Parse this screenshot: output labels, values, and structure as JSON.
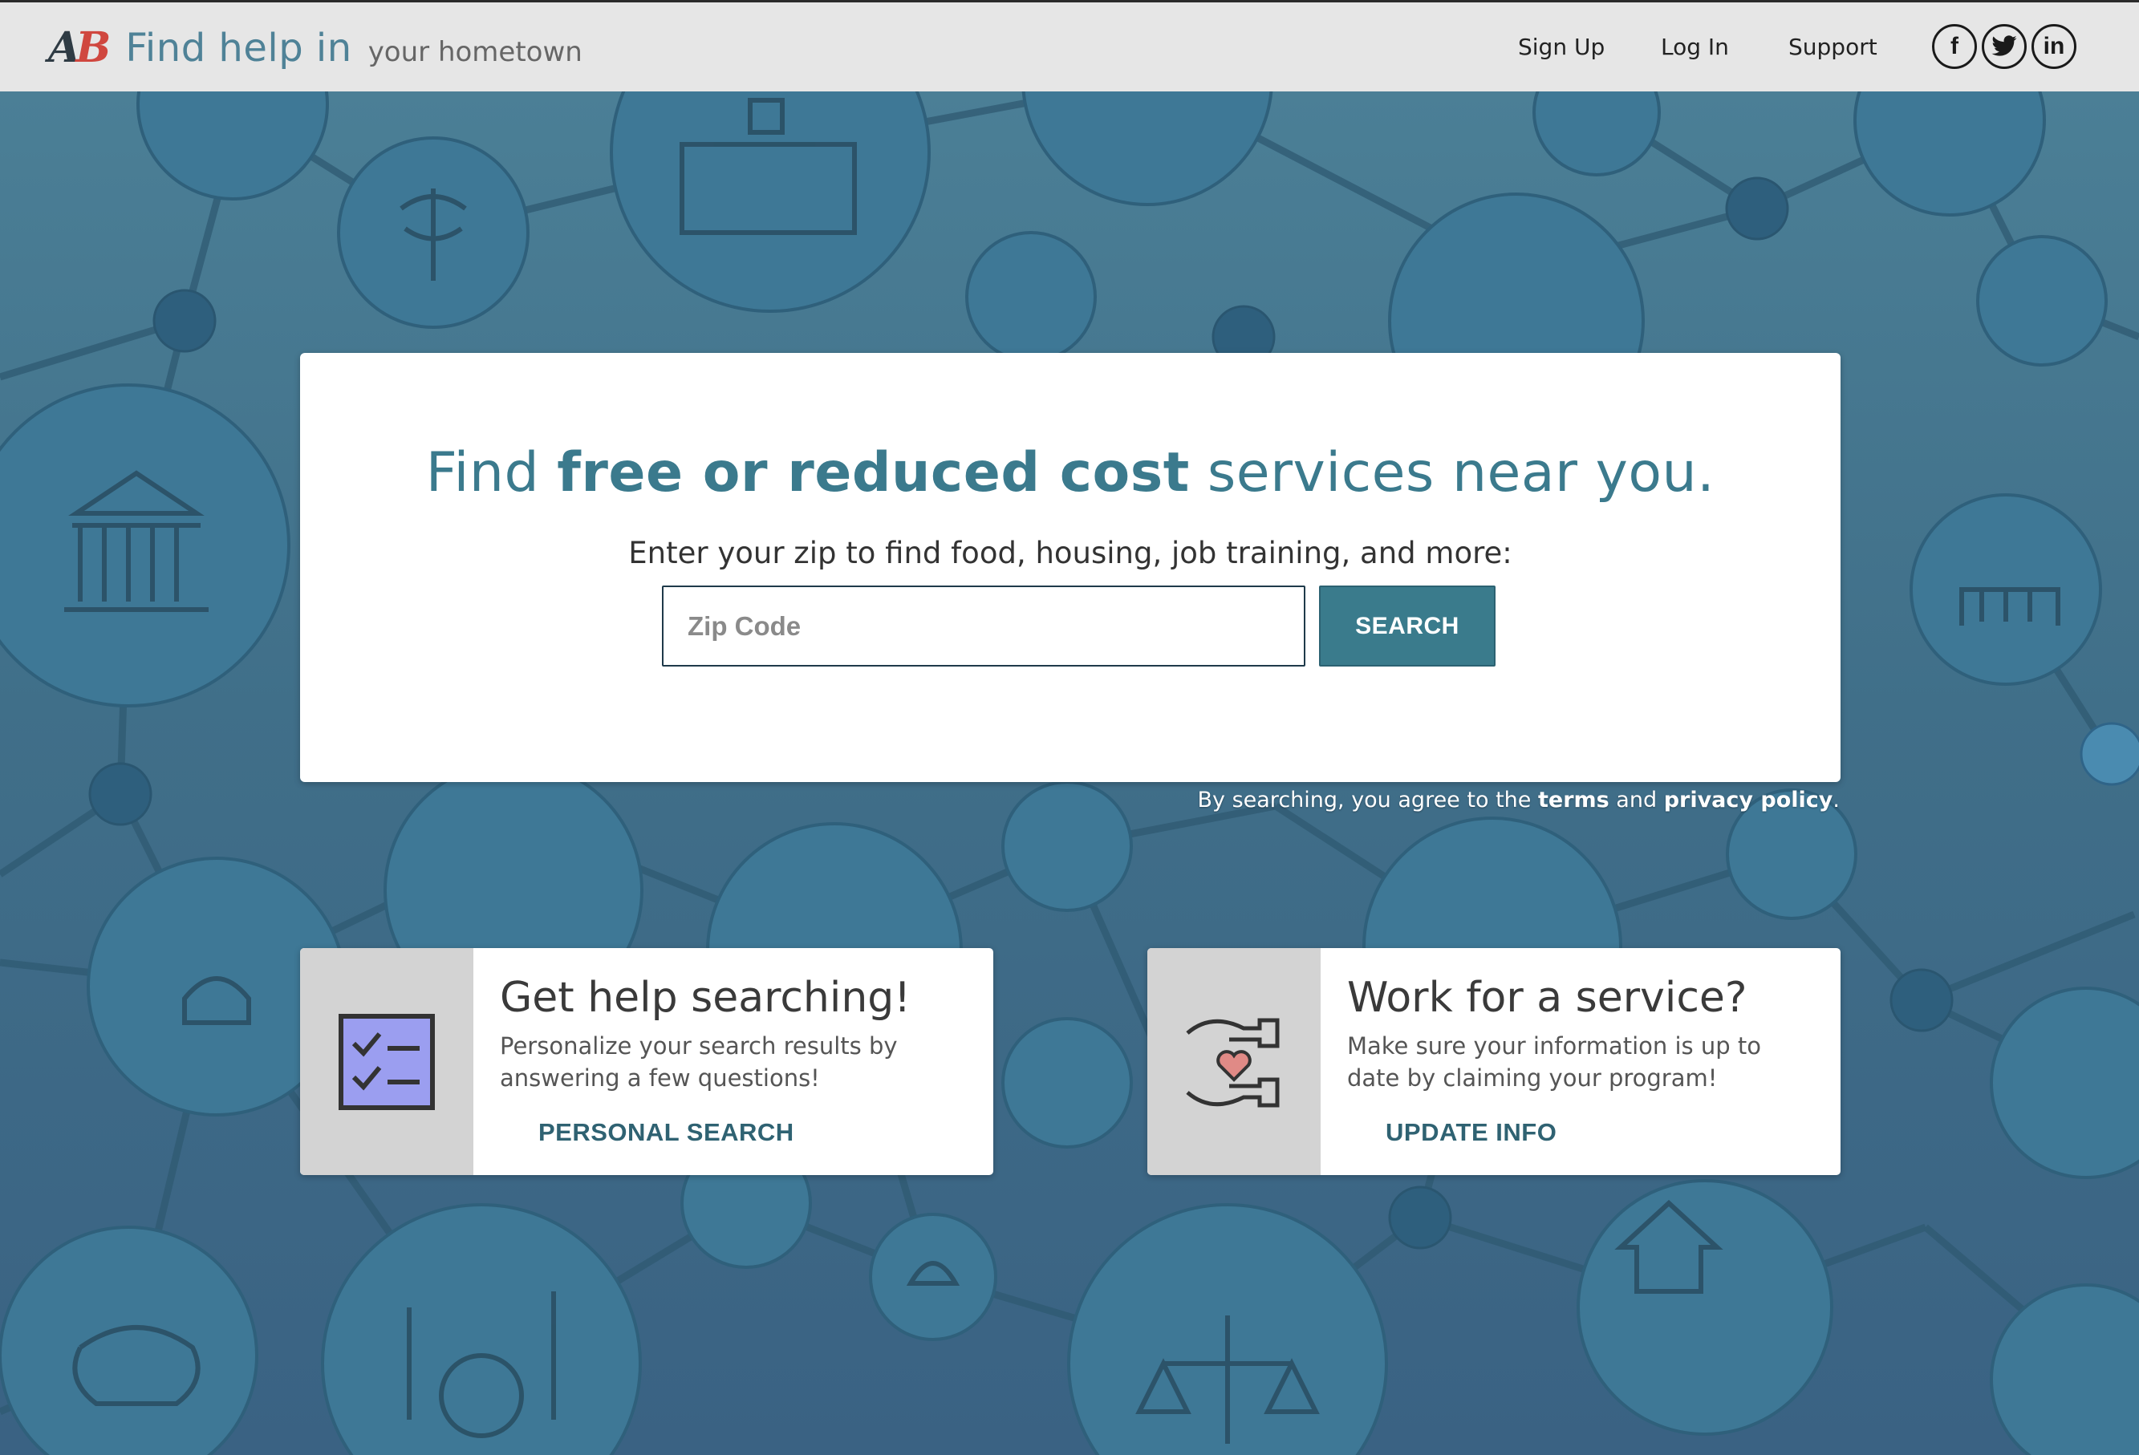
{
  "header": {
    "logo_text_a": "A",
    "logo_text_b": "B",
    "title": "Find help in",
    "subtitle": "your hometown",
    "nav": {
      "sign_up": "Sign Up",
      "log_in": "Log In",
      "support": "Support"
    },
    "social": {
      "facebook": "f",
      "twitter": "t",
      "linkedin": "in"
    }
  },
  "search": {
    "headline_pre": "Find ",
    "headline_bold": "free or reduced cost",
    "headline_post": " services near you.",
    "prompt": "Enter your zip to find food, housing, job training, and more:",
    "placeholder": "Zip Code",
    "value": "",
    "button_label": "SEARCH",
    "terms_pre": "By searching, you agree to the ",
    "terms_link": "terms",
    "terms_mid": " and ",
    "privacy_link": "privacy policy",
    "terms_post": "."
  },
  "cards": [
    {
      "icon": "checklist-icon",
      "title": "Get help searching!",
      "description": "Personalize your search results by answering a few questions!",
      "link": "PERSONAL SEARCH"
    },
    {
      "icon": "hands-heart-icon",
      "title": "Work for a service?",
      "description": "Make sure your information is up to date by claiming your program!",
      "link": "UPDATE INFO"
    }
  ],
  "colors": {
    "brand_teal": "#3b7a8d",
    "button": "#3a7b8c",
    "logo_red": "#d0473f",
    "header_bg": "#e6e6e6",
    "checklist_fill": "#9b9ef0"
  }
}
